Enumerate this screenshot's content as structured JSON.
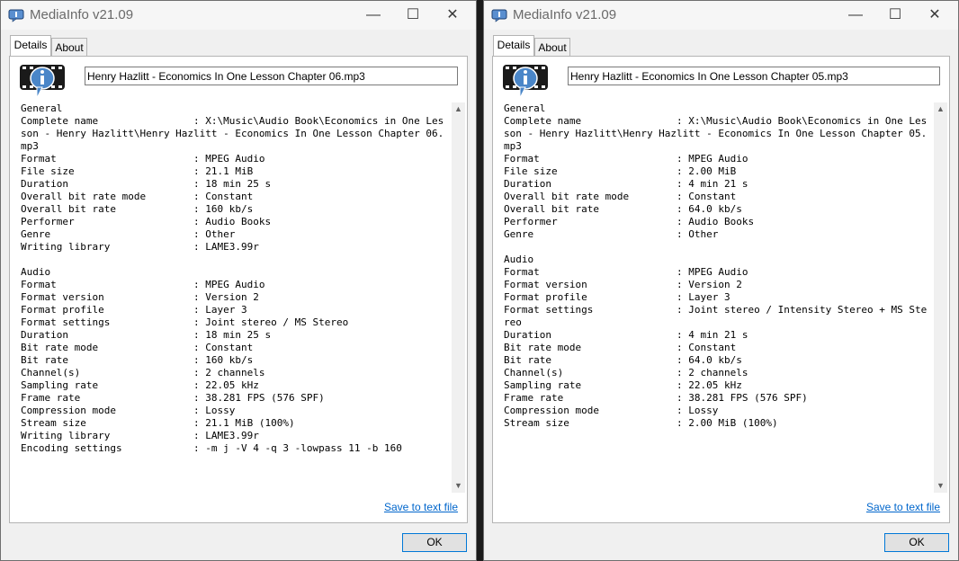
{
  "windows": [
    {
      "title": "MediaInfo v21.09",
      "controls": {
        "minimize": "—",
        "maximize": "☐",
        "close": "✕"
      },
      "tabs": [
        {
          "label": "Details"
        },
        {
          "label": "About"
        }
      ],
      "file_name": "Henry Hazlitt - Economics In One Lesson Chapter 06.mp3",
      "info_text": "General\nComplete name                : X:\\Music\\Audio Book\\Economics in One Lesson - Henry Hazlitt\\Henry Hazlitt - Economics In One Lesson Chapter 06.mp3\nFormat                       : MPEG Audio\nFile size                    : 21.1 MiB\nDuration                     : 18 min 25 s\nOverall bit rate mode        : Constant\nOverall bit rate             : 160 kb/s\nPerformer                    : Audio Books\nGenre                        : Other\nWriting library              : LAME3.99r\n\nAudio\nFormat                       : MPEG Audio\nFormat version               : Version 2\nFormat profile               : Layer 3\nFormat settings              : Joint stereo / MS Stereo\nDuration                     : 18 min 25 s\nBit rate mode                : Constant\nBit rate                     : 160 kb/s\nChannel(s)                   : 2 channels\nSampling rate                : 22.05 kHz\nFrame rate                   : 38.281 FPS (576 SPF)\nCompression mode             : Lossy\nStream size                  : 21.1 MiB (100%)\nWriting library              : LAME3.99r\nEncoding settings            : -m j -V 4 -q 3 -lowpass 11 -b 160",
      "save_link": "Save to text file",
      "ok_label": "OK"
    },
    {
      "title": "MediaInfo v21.09",
      "controls": {
        "minimize": "—",
        "maximize": "☐",
        "close": "✕"
      },
      "tabs": [
        {
          "label": "Details"
        },
        {
          "label": "About"
        }
      ],
      "file_name": "Henry Hazlitt - Economics In One Lesson Chapter 05.mp3",
      "info_text": "General\nComplete name                : X:\\Music\\Audio Book\\Economics in One Lesson - Henry Hazlitt\\Henry Hazlitt - Economics In One Lesson Chapter 05.mp3\nFormat                       : MPEG Audio\nFile size                    : 2.00 MiB\nDuration                     : 4 min 21 s\nOverall bit rate mode        : Constant\nOverall bit rate             : 64.0 kb/s\nPerformer                    : Audio Books\nGenre                        : Other\n\nAudio\nFormat                       : MPEG Audio\nFormat version               : Version 2\nFormat profile               : Layer 3\nFormat settings              : Joint stereo / Intensity Stereo + MS Stereo\nDuration                     : 4 min 21 s\nBit rate mode                : Constant\nBit rate                     : 64.0 kb/s\nChannel(s)                   : 2 channels\nSampling rate                : 22.05 kHz\nFrame rate                   : 38.281 FPS (576 SPF)\nCompression mode             : Lossy\nStream size                  : 2.00 MiB (100%)",
      "save_link": "Save to text file",
      "ok_label": "OK"
    }
  ]
}
